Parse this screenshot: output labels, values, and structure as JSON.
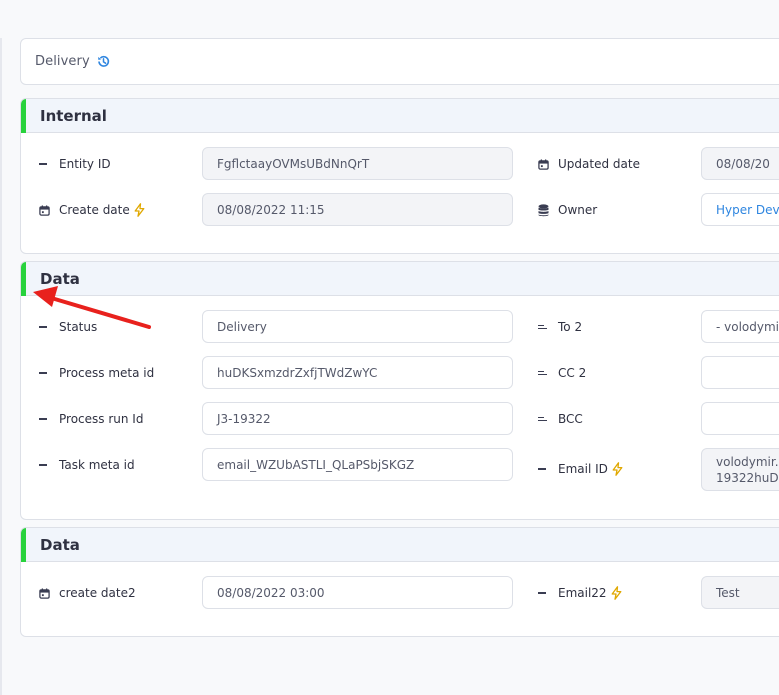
{
  "header": {
    "title": "Delivery",
    "history_icon": "history-icon"
  },
  "colors": {
    "accent_green": "#28d23c",
    "link_blue": "#2f86e0",
    "arrow_red": "#e8211d",
    "bolt_yellow": "#f0b400"
  },
  "sections": [
    {
      "title": "Internal",
      "left_fields": [
        {
          "icon": "dash-icon",
          "label": "Entity ID",
          "value": "FgflctaayOVMsUBdNnQrT",
          "readonly": true
        },
        {
          "icon": "calendar-icon",
          "label": "Create date",
          "bolt": true,
          "value": "08/08/2022 11:15",
          "readonly": true
        }
      ],
      "right_fields": [
        {
          "icon": "calendar-icon",
          "label": "Updated date",
          "value": "08/08/20",
          "readonly": true
        },
        {
          "icon": "database-icon",
          "label": "Owner",
          "value": "Hyper Deve",
          "link": true
        }
      ]
    },
    {
      "title": "Data",
      "left_fields": [
        {
          "icon": "dash-icon",
          "label": "Status",
          "value": "Delivery"
        },
        {
          "icon": "dash-icon",
          "label": "Process meta id",
          "value": "huDKSxmzdrZxfjTWdZwYC"
        },
        {
          "icon": "dash-icon",
          "label": "Process run Id",
          "value": "J3-19322"
        },
        {
          "icon": "dash-icon",
          "label": "Task meta id",
          "value": "email_WZUbASTLI_QLaPSbjSKGZ"
        }
      ],
      "right_fields": [
        {
          "icon": "lines-icon",
          "label": "To 2",
          "value": "- volodymir"
        },
        {
          "icon": "lines-icon",
          "label": "CC 2",
          "value": ""
        },
        {
          "icon": "lines-icon",
          "label": "BCC",
          "value": ""
        },
        {
          "icon": "dash-icon",
          "label": "Email ID",
          "bolt": true,
          "value_line1": "volodymir.c",
          "value_line2": "19322huD",
          "readonly": true
        }
      ]
    },
    {
      "title": "Data",
      "left_fields": [
        {
          "icon": "calendar-icon",
          "label": "create date2",
          "value": "08/08/2022 03:00"
        }
      ],
      "right_fields": [
        {
          "icon": "dash-icon",
          "label": "Email22",
          "bolt": true,
          "value": "Test"
        }
      ]
    }
  ]
}
